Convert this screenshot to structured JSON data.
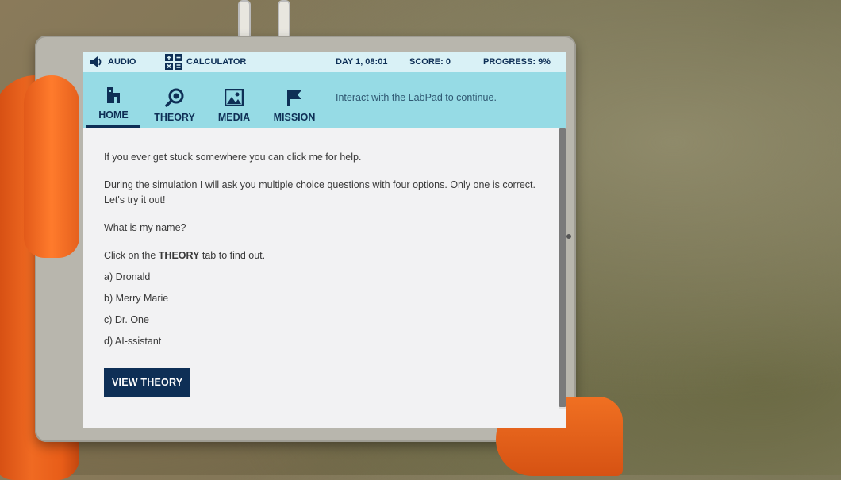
{
  "topbar": {
    "audio_label": "AUDIO",
    "calculator_label": "CALCULATOR",
    "day_time": "DAY 1, 08:01",
    "score": "SCORE: 0",
    "progress": "PROGRESS: 9%"
  },
  "nav": {
    "tabs": [
      {
        "label": "HOME",
        "icon": "home-icon"
      },
      {
        "label": "THEORY",
        "icon": "theory-icon"
      },
      {
        "label": "MEDIA",
        "icon": "media-icon"
      },
      {
        "label": "MISSION",
        "icon": "flag-icon"
      }
    ],
    "active_tab": "HOME",
    "hint": "Interact with the LabPad to continue."
  },
  "content": {
    "help_text": "If you ever get stuck somewhere you can click me for help.",
    "intro_text": "During the simulation I will ask you multiple choice questions with four options. Only one is correct. Let's try it out!",
    "question": "What is my name?",
    "instruction_prefix": "Click on the ",
    "instruction_bold": "THEORY",
    "instruction_suffix": " tab to find out.",
    "options": [
      "a)  Dronald",
      "b)  Merry Marie",
      "c)  Dr. One",
      "d)  AI-ssistant"
    ],
    "button_label": "VIEW THEORY"
  },
  "colors": {
    "navy": "#0e2f56",
    "topbar_bg": "#d9f1f6",
    "navbar_bg": "#96dbe5",
    "content_bg": "#f2f2f3"
  }
}
